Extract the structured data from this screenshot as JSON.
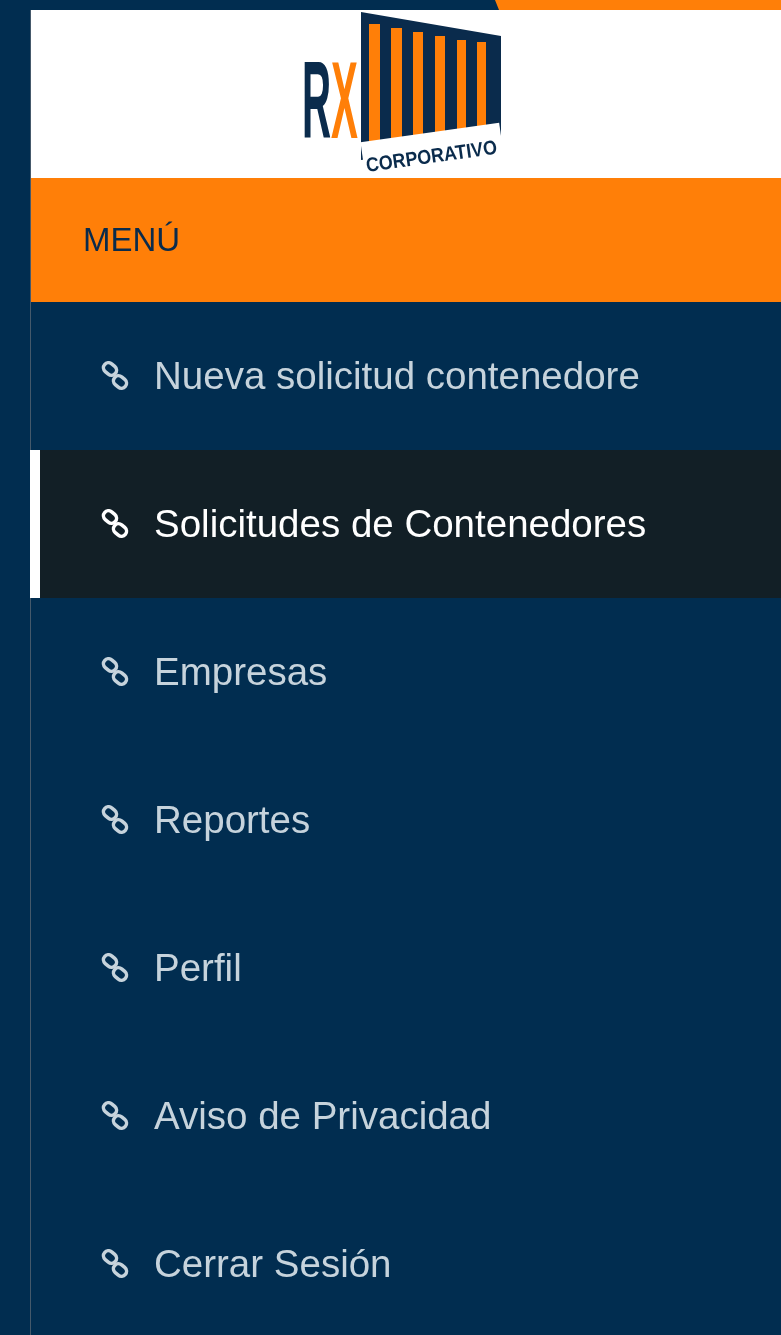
{
  "logo": {
    "letters": "RX",
    "tagline": "CORPORATIVO"
  },
  "menu_header": "MENÚ",
  "menu_items": [
    {
      "label": "Nueva solicitud contenedore",
      "selected": false
    },
    {
      "label": "Solicitudes de Contenedores",
      "selected": true
    },
    {
      "label": "Empresas",
      "selected": false
    },
    {
      "label": "Reportes",
      "selected": false
    },
    {
      "label": "Perfil",
      "selected": false
    },
    {
      "label": "Aviso de Privacidad",
      "selected": false
    },
    {
      "label": "Cerrar Sesión",
      "selected": false
    }
  ]
}
